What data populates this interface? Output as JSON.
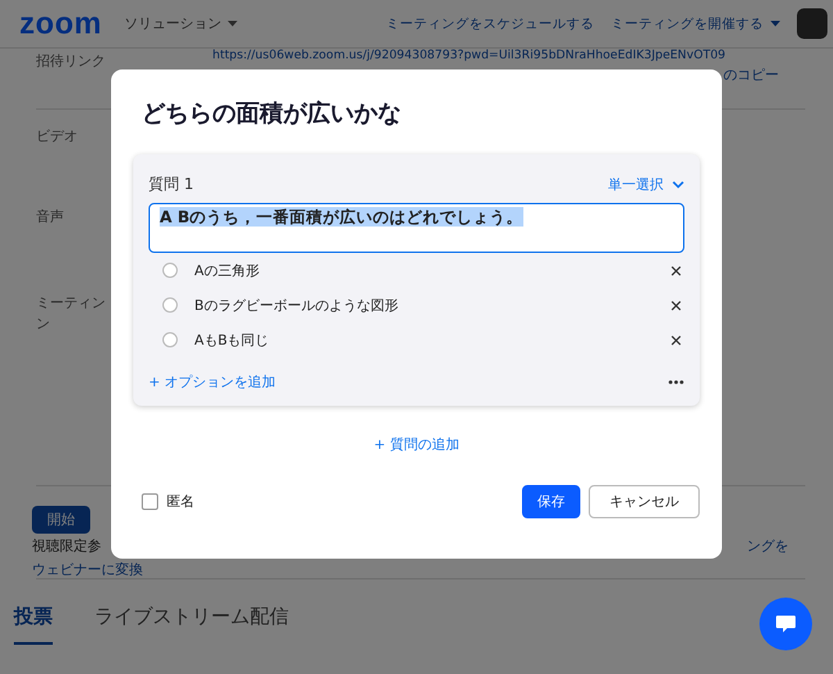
{
  "header": {
    "logo": "zoom",
    "menu": "ソリューション",
    "links": [
      {
        "label": "ミーティングをスケジュールする",
        "dropdown": false
      },
      {
        "label": "ミーティングを開催する",
        "dropdown": true
      }
    ]
  },
  "page": {
    "invite_label": "招待リンク",
    "invite_url": "https://us06web.zoom.us/j/92094308793?pwd=Uil3Ri95bDNraHhoeEdIK3JpeENvOT09",
    "copy_link": "のコピー",
    "video_label": "ビデオ",
    "audio_label": "音声",
    "option_label": [
      "ミーティン",
      "ン"
    ],
    "start_button": "開始",
    "view_only_text": "視聴限定参",
    "convert_link": "ウェビナーに変換",
    "right_link": "ングを"
  },
  "tabs": [
    {
      "label": "投票",
      "selected": true
    },
    {
      "label": "ライブストリーム配信",
      "selected": false
    }
  ],
  "modal": {
    "title": "どちらの面積が広いかな",
    "question": {
      "label": "質問 1",
      "type": "単一選択",
      "text": "A Bのうち，一番面積が広いのはどれでしょう。",
      "options": [
        {
          "label": "Aの三角形",
          "selected": false
        },
        {
          "label": "Bのラグビーボールのような図形",
          "selected": false
        },
        {
          "label": "AもBも同じ",
          "selected": false
        }
      ],
      "add_option": "+ オプションを追加"
    },
    "add_question": "+ 質問の追加",
    "anonymous": {
      "label": "匿名",
      "checked": false
    },
    "buttons": [
      {
        "label": "保存",
        "kind": "primary"
      },
      {
        "label": "キャンセル",
        "kind": "secondary"
      }
    ]
  }
}
